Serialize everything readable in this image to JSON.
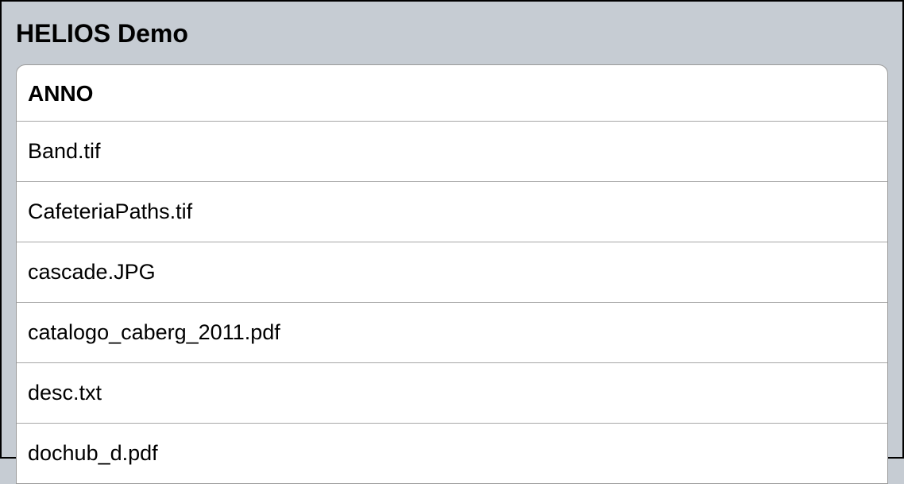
{
  "header": {
    "title": "HELIOS Demo"
  },
  "list": {
    "section_title": "ANNO",
    "items": [
      {
        "name": "Band.tif"
      },
      {
        "name": "CafeteriaPaths.tif"
      },
      {
        "name": "cascade.JPG"
      },
      {
        "name": "catalogo_caberg_2011.pdf"
      },
      {
        "name": "desc.txt"
      },
      {
        "name": "dochub_d.pdf"
      }
    ]
  }
}
